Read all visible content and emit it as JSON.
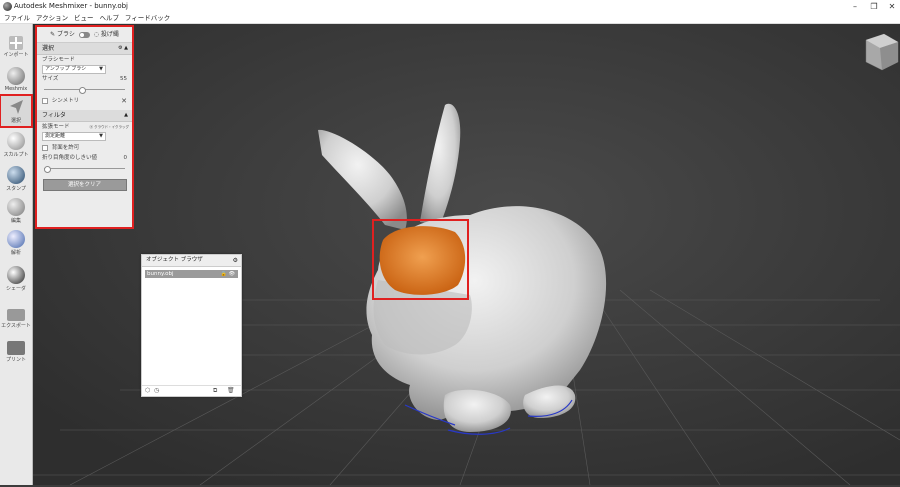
{
  "window": {
    "title": "Autodesk Meshmixer - bunny.obj"
  },
  "menu": [
    "ファイル",
    "アクション",
    "ビュー",
    "ヘルプ",
    "フィードバック"
  ],
  "toolbar": [
    {
      "label": "インポート",
      "icon": "plus-icon"
    },
    {
      "label": "Meshmix",
      "icon": "meshmix-icon"
    },
    {
      "label": "選択",
      "icon": "select-arrow-icon",
      "active": true
    },
    {
      "label": "スカルプト",
      "icon": "brush-icon"
    },
    {
      "label": "スタンプ",
      "icon": "stamp-icon"
    },
    {
      "label": "編集",
      "icon": "edit-icon"
    },
    {
      "label": "解析",
      "icon": "analysis-icon"
    },
    {
      "label": "シェーダ",
      "icon": "shader-icon"
    },
    {
      "label": "エクスポート",
      "icon": "export-icon"
    },
    {
      "label": "プリント",
      "icon": "print-icon"
    }
  ],
  "panel": {
    "mode_brush": "ブラシ",
    "mode_lasso": "投げ縄",
    "section1": {
      "title": "選択",
      "brush_mode_label": "ブラシモード",
      "brush_mode_value": "アンフップ ブラシ",
      "size_label": "サイズ",
      "size_value": "55",
      "size_fraction": 0.47,
      "symmetry_label": "シンメトリ"
    },
    "section2": {
      "title": "フィルタ",
      "expand_mode_label": "拡張モード",
      "expand_mode_hint": "ⓐ クラウド・イクラッグ",
      "expand_mode_value": "測定距離",
      "backface_label": "背面を許可",
      "crease_label": "折り目角度のしきい値",
      "crease_value": "0",
      "crease_fraction": 0.0
    },
    "clear_button": "選択をクリア"
  },
  "object_browser": {
    "title": "オブジェクト ブラウザ",
    "items": [
      {
        "name": "bunny.obj"
      }
    ]
  },
  "colors": {
    "selection": "#e07a20",
    "highlight": "#e02020",
    "viewport_bg": "#3c3c3c",
    "mesh": "#d8d8d8"
  }
}
